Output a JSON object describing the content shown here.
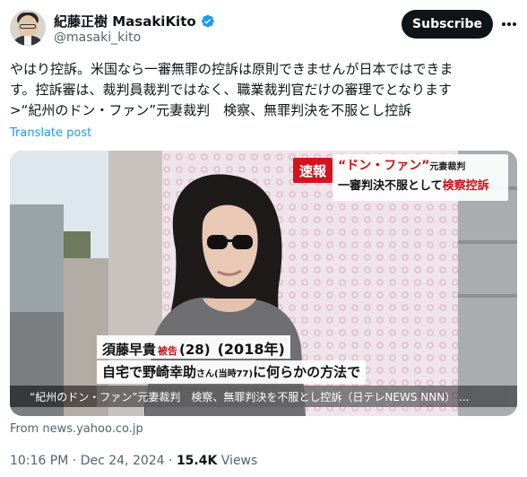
{
  "author": {
    "display_name": "紀藤正樹 MasakiKito",
    "handle": "@masaki_kito",
    "verified_icon": "verified-badge-icon",
    "verified_color": "#1d9bf0"
  },
  "actions": {
    "subscribe_label": "Subscribe",
    "more_icon": "more-horizontal-icon"
  },
  "tweet": {
    "lines": [
      "やはり控訴。米国なら一審無罪の控訴は原則できませんが日本ではできま",
      "す。控訴審は、裁判員裁判ではなく、職業裁判官だけの審理でとなります",
      ">“紀州のドン・ファン”元妻裁判　検察、無罪判決を不服とし控訴"
    ],
    "translate_label": "Translate post"
  },
  "media": {
    "badge": "速報",
    "headline_main": "“ドン・ファン”",
    "headline_small": "元妻裁判",
    "headline2_prefix": "一審判決不服として",
    "headline2_red": "検察控訴",
    "caption_name": "須藤早貴",
    "caption_role": "被告",
    "caption_age": "(28)",
    "caption_year": "(2018年)",
    "caption_line1_a": "自宅で野崎幸助",
    "caption_line1_small": "さん(当時77)",
    "caption_line1_b": "に何らかの方法で",
    "video_title": "“紀州のドン・ファン”元妻裁判　検察、無罪判決を不服とし控訴（日テレNEWS NNN） ..."
  },
  "source_text": "From news.yahoo.co.jp",
  "meta": {
    "time": "10:16 PM",
    "date": "Dec 24, 2024",
    "separator": "·",
    "views_count": "15.4K",
    "views_label": "Views"
  },
  "colors": {
    "link": "#1d9bf0",
    "text": "#0f1419",
    "secondary": "#536471",
    "badge_red": "#d3141c"
  }
}
